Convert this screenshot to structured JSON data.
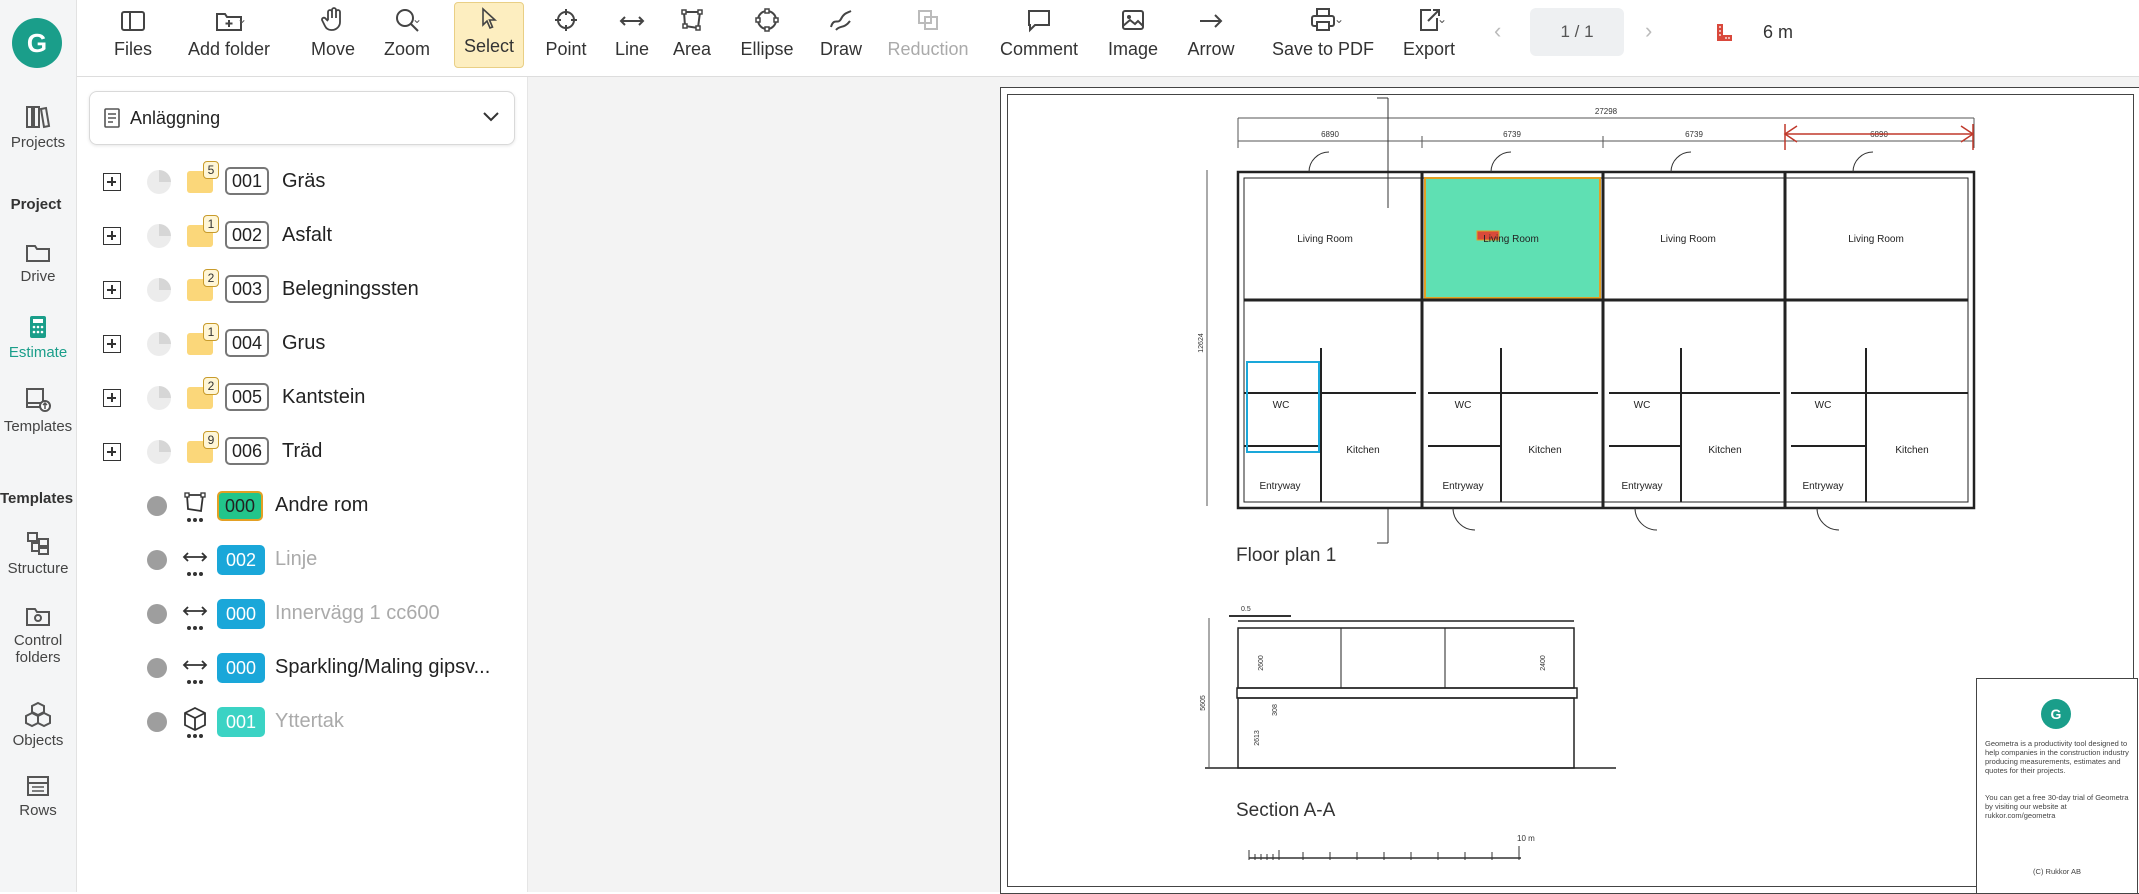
{
  "app": {
    "logo_letter": "G",
    "accent": "#1a9e8a"
  },
  "nav": {
    "projects": "Projects",
    "section_project": "Project",
    "drive": "Drive",
    "estimate": "Estimate",
    "templates": "Templates",
    "section_templates": "Templates",
    "structure": "Structure",
    "control_folders_1": "Control",
    "control_folders_2": "folders",
    "objects": "Objects",
    "rows": "Rows"
  },
  "toolbar": {
    "files": "Files",
    "add_folder": "Add folder",
    "move": "Move",
    "zoom": "Zoom",
    "select": "Select",
    "point": "Point",
    "line": "Line",
    "area": "Area",
    "ellipse": "Ellipse",
    "draw": "Draw",
    "reduction": "Reduction",
    "comment": "Comment",
    "image": "Image",
    "arrow": "Arrow",
    "save_pdf": "Save to PDF",
    "export": "Export",
    "page_indicator": "1 / 1",
    "scale": "6 m"
  },
  "panel": {
    "selected_folder": "Anläggning",
    "folders": [
      {
        "code": "001",
        "name": "Gräs",
        "count": "5"
      },
      {
        "code": "002",
        "name": "Asfalt",
        "count": "1"
      },
      {
        "code": "003",
        "name": "Belegningssten",
        "count": "2"
      },
      {
        "code": "004",
        "name": "Grus",
        "count": "1"
      },
      {
        "code": "005",
        "name": "Kantstein",
        "count": "2"
      },
      {
        "code": "006",
        "name": "Träd",
        "count": "9"
      }
    ],
    "templates": [
      {
        "code": "000",
        "name": "Andre rom",
        "color": "#22c58b",
        "icon": "area-icon"
      },
      {
        "code": "002",
        "name": "Linje",
        "color": "#1aa7d9",
        "icon": "line-icon"
      },
      {
        "code": "000",
        "name": "Innervägg 1 cc600",
        "color": "#1aa7d9",
        "icon": "line-icon"
      },
      {
        "code": "000",
        "name": "Sparkling/Maling gipsv...",
        "color": "#1aa7d9",
        "icon": "line-icon"
      },
      {
        "code": "001",
        "name": "Yttertak",
        "color": "#3bd3c4",
        "icon": "cube-icon"
      }
    ]
  },
  "drawing": {
    "floor_plan_title": "Floor plan 1",
    "section_title": "Section A-A",
    "rooms": {
      "living": "Living Room",
      "wc": "WC",
      "kitchen": "Kitchen",
      "entryway": "Entryway"
    },
    "dim_total": "27298",
    "dim_segments": [
      "6890",
      "6739",
      "6739",
      "6890"
    ],
    "dim_height": "12624",
    "scale_bar_label": "10 m",
    "infobox_text_1": "Geometra is a productivity tool designed to help companies in the construction industry producing measurements, estimates and quotes for their projects.",
    "infobox_text_2": "You can get a free 30-day trial of Geometra by visiting our website at rukkor.com/geometra",
    "infobox_copyright": "(C) Rukkor AB",
    "section_dims": [
      "0.5",
      "2600",
      "2400",
      "5605",
      "308",
      "2613"
    ]
  }
}
